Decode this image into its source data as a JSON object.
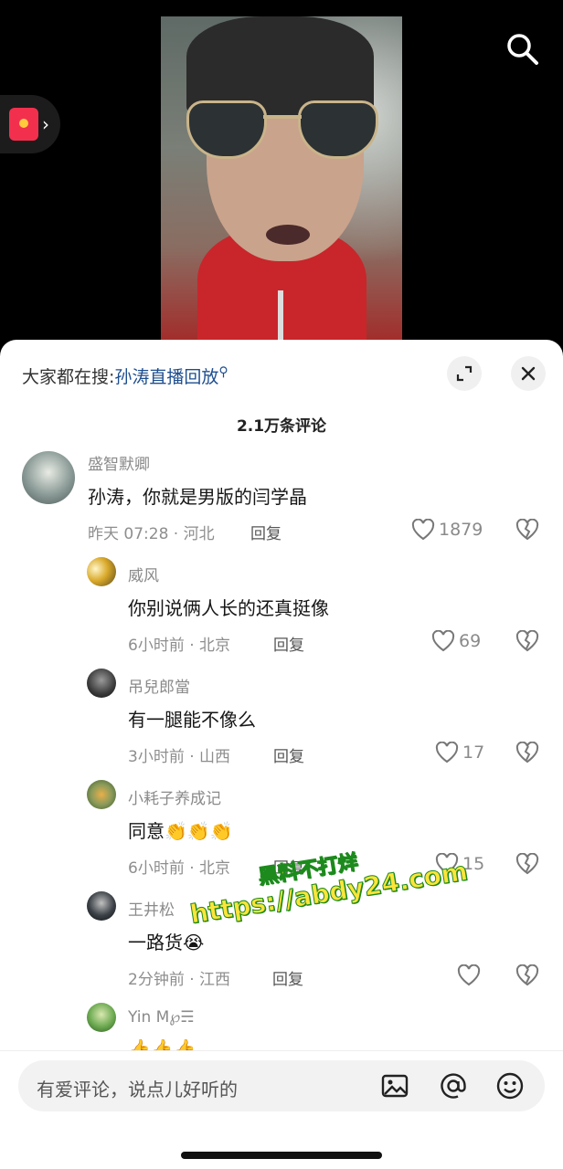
{
  "hot_search": {
    "prefix": "大家都在搜:",
    "keyword": "孙涛直播回放"
  },
  "comment_count": "2.1万条评论",
  "comments": [
    {
      "name": "盛智默卿",
      "text": "孙涛，你就是男版的闫学晶",
      "time": "昨天 07:28",
      "location": "河北",
      "reply": "回复",
      "likes": "1879"
    },
    {
      "name": "威风",
      "text": "你别说俩人长的还真挺像",
      "time": "6小时前",
      "location": "北京",
      "reply": "回复",
      "likes": "69"
    },
    {
      "name": "吊兒郎當",
      "text": "有一腿能不像么",
      "time": "3小时前",
      "location": "山西",
      "reply": "回复",
      "likes": "17"
    },
    {
      "name": "小耗子养成记",
      "text": "同意",
      "emoji": "👏👏👏",
      "time": "6小时前",
      "location": "北京",
      "reply": "回复",
      "likes": "15"
    },
    {
      "name": "王井松",
      "text": "一路货",
      "emoji": "😭",
      "time": "2分钟前",
      "location": "江西",
      "reply": "回复",
      "likes": ""
    },
    {
      "name": "Yin M",
      "name_suffix": "℘☴",
      "text": "",
      "emoji": "👍👍👍"
    }
  ],
  "input": {
    "placeholder": "有爱评论，说点儿好听的"
  },
  "watermark": {
    "line1": "黑料不打烊",
    "line2": "https://abdy24.com"
  },
  "icons": [
    "search-icon",
    "red-packet-icon",
    "expand-icon",
    "close-icon",
    "heart-icon",
    "heart-broken-icon",
    "image-icon",
    "at-icon",
    "emoji-icon"
  ],
  "colors": {
    "keyword": "#1d4e8f",
    "sheet_bg": "#ffffff",
    "watermark": "#ffe43a"
  }
}
